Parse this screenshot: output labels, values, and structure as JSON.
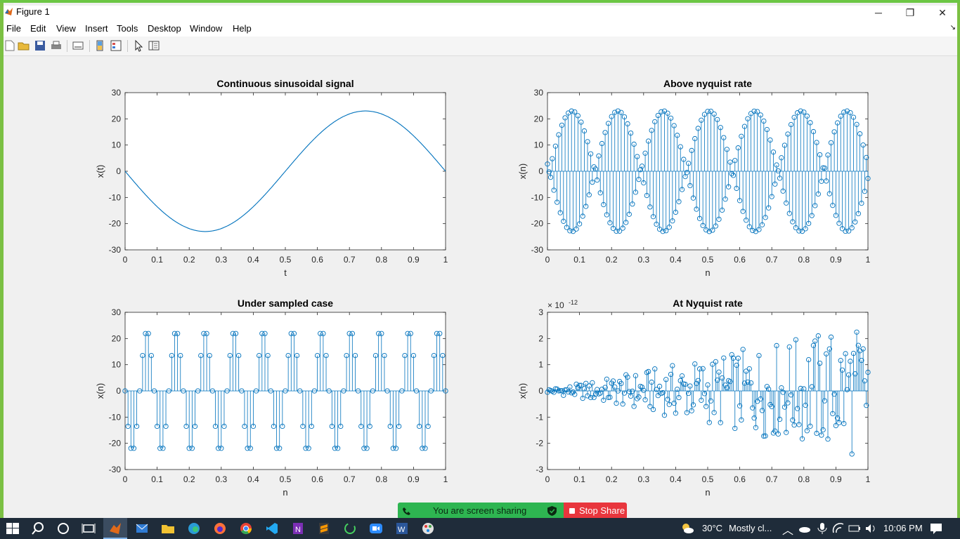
{
  "window": {
    "title": "Figure 1",
    "minimize": "─",
    "maximize": "❐",
    "close": "✕"
  },
  "menu": [
    "File",
    "Edit",
    "View",
    "Insert",
    "Tools",
    "Desktop",
    "Window",
    "Help"
  ],
  "toolbar": {
    "icons": [
      "new-figure-icon",
      "open-file-icon",
      "save-icon",
      "print-icon",
      "link-plot-icon",
      "colorbar-icon",
      "legend-icon",
      "pointer-icon",
      "property-inspector-icon"
    ]
  },
  "colors": {
    "plot_blue": "#0072bd",
    "accent_green": "#7bc043",
    "share_green": "#2eb551",
    "stop_red": "#e8363d"
  },
  "chart_data": [
    {
      "type": "line",
      "title": "Continuous sinusoidal signal",
      "xlabel": "t",
      "ylabel": "x(t)",
      "xlim": [
        0,
        1
      ],
      "ylim": [
        -30,
        30
      ],
      "xticks": [
        "0",
        "0.1",
        "0.2",
        "0.3",
        "0.4",
        "0.5",
        "0.6",
        "0.7",
        "0.8",
        "0.9",
        "1"
      ],
      "yticks": [
        "30",
        "20",
        "10",
        "0",
        "-10",
        "-20",
        "-30"
      ],
      "series": [
        {
          "function": "-23*sin(2*pi*t)",
          "amplitude": 23,
          "frequency": 1,
          "phase_sign": -1
        }
      ]
    },
    {
      "type": "stem",
      "title": "Above nyquist rate",
      "xlabel": "n",
      "ylabel": "x(n)",
      "xlim": [
        0,
        1
      ],
      "ylim": [
        -30,
        30
      ],
      "xticks": [
        "0",
        "0.1",
        "0.2",
        "0.3",
        "0.4",
        "0.5",
        "0.6",
        "0.7",
        "0.8",
        "0.9",
        "1"
      ],
      "yticks": [
        "30",
        "20",
        "10",
        "0",
        "-10",
        "-20",
        "-30"
      ],
      "series": [
        {
          "amplitude": 23,
          "samples": 201,
          "n_range": [
            0,
            1
          ],
          "envelope_cycles": 7
        }
      ]
    },
    {
      "type": "stem",
      "title": "Under sampled case",
      "xlabel": "n",
      "ylabel": "x(n)",
      "xlim": [
        0,
        1
      ],
      "ylim": [
        -30,
        30
      ],
      "xticks": [
        "0",
        "0.1",
        "0.2",
        "0.3",
        "0.4",
        "0.5",
        "0.6",
        "0.7",
        "0.8",
        "0.9",
        "1"
      ],
      "yticks": [
        "30",
        "20",
        "10",
        "0",
        "-10",
        "-20",
        "-30"
      ],
      "series": [
        {
          "values_cycle": [
            0,
            -13.5,
            -21.9,
            -21.9,
            -13.5,
            0,
            13.5,
            21.9,
            21.9,
            13.5
          ],
          "samples": 111,
          "n_range": [
            0,
            1
          ]
        }
      ]
    },
    {
      "type": "stem",
      "title": "At Nyquist rate",
      "xlabel": "n",
      "ylabel": "x(n)",
      "xlim": [
        0,
        1
      ],
      "ylim": [
        -3,
        3
      ],
      "y_exponent": "× 10",
      "y_exponent_power": "-12",
      "xticks": [
        "0",
        "0.1",
        "0.2",
        "0.3",
        "0.4",
        "0.5",
        "0.6",
        "0.7",
        "0.8",
        "0.9",
        "1"
      ],
      "yticks": [
        "3",
        "2",
        "1",
        "0",
        "-1",
        "-2",
        "-3"
      ],
      "series": [
        {
          "samples": 201,
          "n_range": [
            0,
            1
          ],
          "note_max_abs": 2.8
        }
      ]
    }
  ],
  "share": {
    "status": "You are screen sharing",
    "stop_label": "Stop Share"
  },
  "taskbar": {
    "weather_temp": "30°C",
    "weather_desc": "Mostly cl...",
    "time": "10:06 PM"
  }
}
